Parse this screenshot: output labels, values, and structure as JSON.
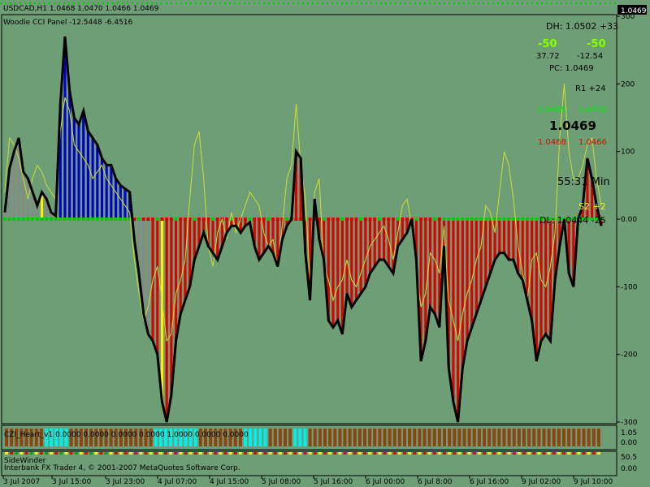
{
  "window": {
    "symbol_line": "USDCAD,H1  1.0468 1.0470 1.0466 1.0469",
    "price_badge": "1.0469"
  },
  "main_indicator": {
    "label": "Woodie CCI Panel -12.5448 -6.4516"
  },
  "info_panel": {
    "dh": "DH: 1.0502 +33",
    "cci_a": "-50",
    "cci_b": "-50",
    "val_a": "37.72",
    "val_b": "-12.54",
    "pc": "PC: 1.0469",
    "r1": "R1 +24",
    "green_a": "1.0485",
    "green_b": "1.0470",
    "big_price": "1.0469",
    "red_a": "1.0468",
    "red_b": "1.0466",
    "timer": "55:31 Min",
    "s2": "S2 +2",
    "dl": "DL: 1.0444 -25"
  },
  "sub1": {
    "label": "CZI_Heart_v1 0.0000 0.0000 0.0000 0.0000 1.0000 0.0000 0.0000"
  },
  "sub2": {
    "label": "SideWinder"
  },
  "footer": {
    "label": "Interbank FX Trader 4, © 2001-2007 MetaQuotes Software Corp."
  },
  "colors": {
    "background": "#6e9e76",
    "bar_gray": "#888888",
    "bar_blue": "#0000cc",
    "bar_red": "#dd0000",
    "bar_yellow": "#ffee00",
    "cci_line": "#000000",
    "turbo_line": "#ccdd33",
    "zero_dots": "#00cc00",
    "heart_cyan": "#00eeee",
    "heart_brown": "#8b4513"
  },
  "chart_data": {
    "type": "bar",
    "title": "Woodie CCI Panel",
    "y_axis_ticks": [
      "300",
      "200",
      "100",
      "0.00",
      "-100",
      "-200",
      "-300"
    ],
    "ylim": [
      -300,
      300
    ],
    "x_tick_labels": [
      "3 Jul 2007",
      "3 Jul 15:00",
      "3 Jul 23:00",
      "4 Jul 07:00",
      "4 Jul 15:00",
      "5 Jul 08:00",
      "5 Jul 16:00",
      "6 Jul 00:00",
      "6 Jul 8:00",
      "6 Jul 16:00",
      "9 Jul 02:00",
      "9 Jul 10:00"
    ],
    "sub1_y_ticks": [
      "1.05",
      "0.00"
    ],
    "sub2_y_ticks": [
      "50.5",
      "0.00"
    ],
    "cci": [
      10,
      75,
      100,
      120,
      70,
      60,
      40,
      20,
      40,
      30,
      10,
      5,
      170,
      270,
      190,
      150,
      140,
      160,
      130,
      120,
      110,
      90,
      80,
      80,
      60,
      50,
      45,
      40,
      -30,
      -80,
      -140,
      -170,
      -180,
      -200,
      -270,
      -300,
      -260,
      -180,
      -140,
      -120,
      -100,
      -60,
      -40,
      -20,
      -40,
      -50,
      -60,
      -40,
      -20,
      -10,
      -10,
      -20,
      -10,
      -5,
      -40,
      -60,
      -50,
      -40,
      -50,
      -70,
      -30,
      -10,
      0,
      100,
      90,
      -50,
      -120,
      30,
      -30,
      -60,
      -150,
      -160,
      -150,
      -170,
      -110,
      -130,
      -120,
      -110,
      -100,
      -80,
      -70,
      -60,
      -60,
      -70,
      -80,
      -40,
      -30,
      -20,
      0,
      -60,
      -210,
      -180,
      -130,
      -140,
      -160,
      -40,
      -220,
      -270,
      -300,
      -220,
      -180,
      -160,
      -140,
      -120,
      -100,
      -80,
      -60,
      -50,
      -50,
      -60,
      -60,
      -80,
      -90,
      -120,
      -150,
      -210,
      -180,
      -170,
      -180,
      -90,
      -40,
      0,
      -80,
      -100,
      0,
      20,
      90,
      60,
      20,
      -10
    ],
    "turbo": [
      40,
      120,
      110,
      90,
      60,
      30,
      60,
      80,
      70,
      50,
      40,
      30,
      130,
      180,
      160,
      110,
      100,
      90,
      80,
      60,
      70,
      80,
      60,
      50,
      40,
      30,
      20,
      10,
      -60,
      -110,
      -150,
      -130,
      -90,
      -70,
      -120,
      -180,
      -170,
      -110,
      -90,
      -60,
      30,
      110,
      130,
      60,
      -40,
      -70,
      -20,
      0,
      -30,
      10,
      -20,
      0,
      20,
      40,
      30,
      20,
      -20,
      -40,
      -30,
      -70,
      -10,
      60,
      80,
      170,
      80,
      30,
      -90,
      40,
      60,
      -70,
      -90,
      -120,
      -100,
      -90,
      -60,
      -90,
      -100,
      -80,
      -60,
      -40,
      -30,
      -20,
      -10,
      -30,
      -60,
      -20,
      20,
      30,
      -10,
      -70,
      -130,
      -110,
      -50,
      -60,
      -80,
      -10,
      -120,
      -150,
      -180,
      -140,
      -110,
      -90,
      -60,
      -40,
      20,
      10,
      -20,
      40,
      100,
      80,
      30,
      -40,
      -80,
      -120,
      -60,
      -50,
      -90,
      -100,
      -70,
      -20,
      120,
      200,
      100,
      60,
      60,
      80,
      110,
      120,
      60,
      20
    ],
    "bar_colors_note": "gray before trend, blue uptrend, red downtrend, yellow on trend change"
  }
}
